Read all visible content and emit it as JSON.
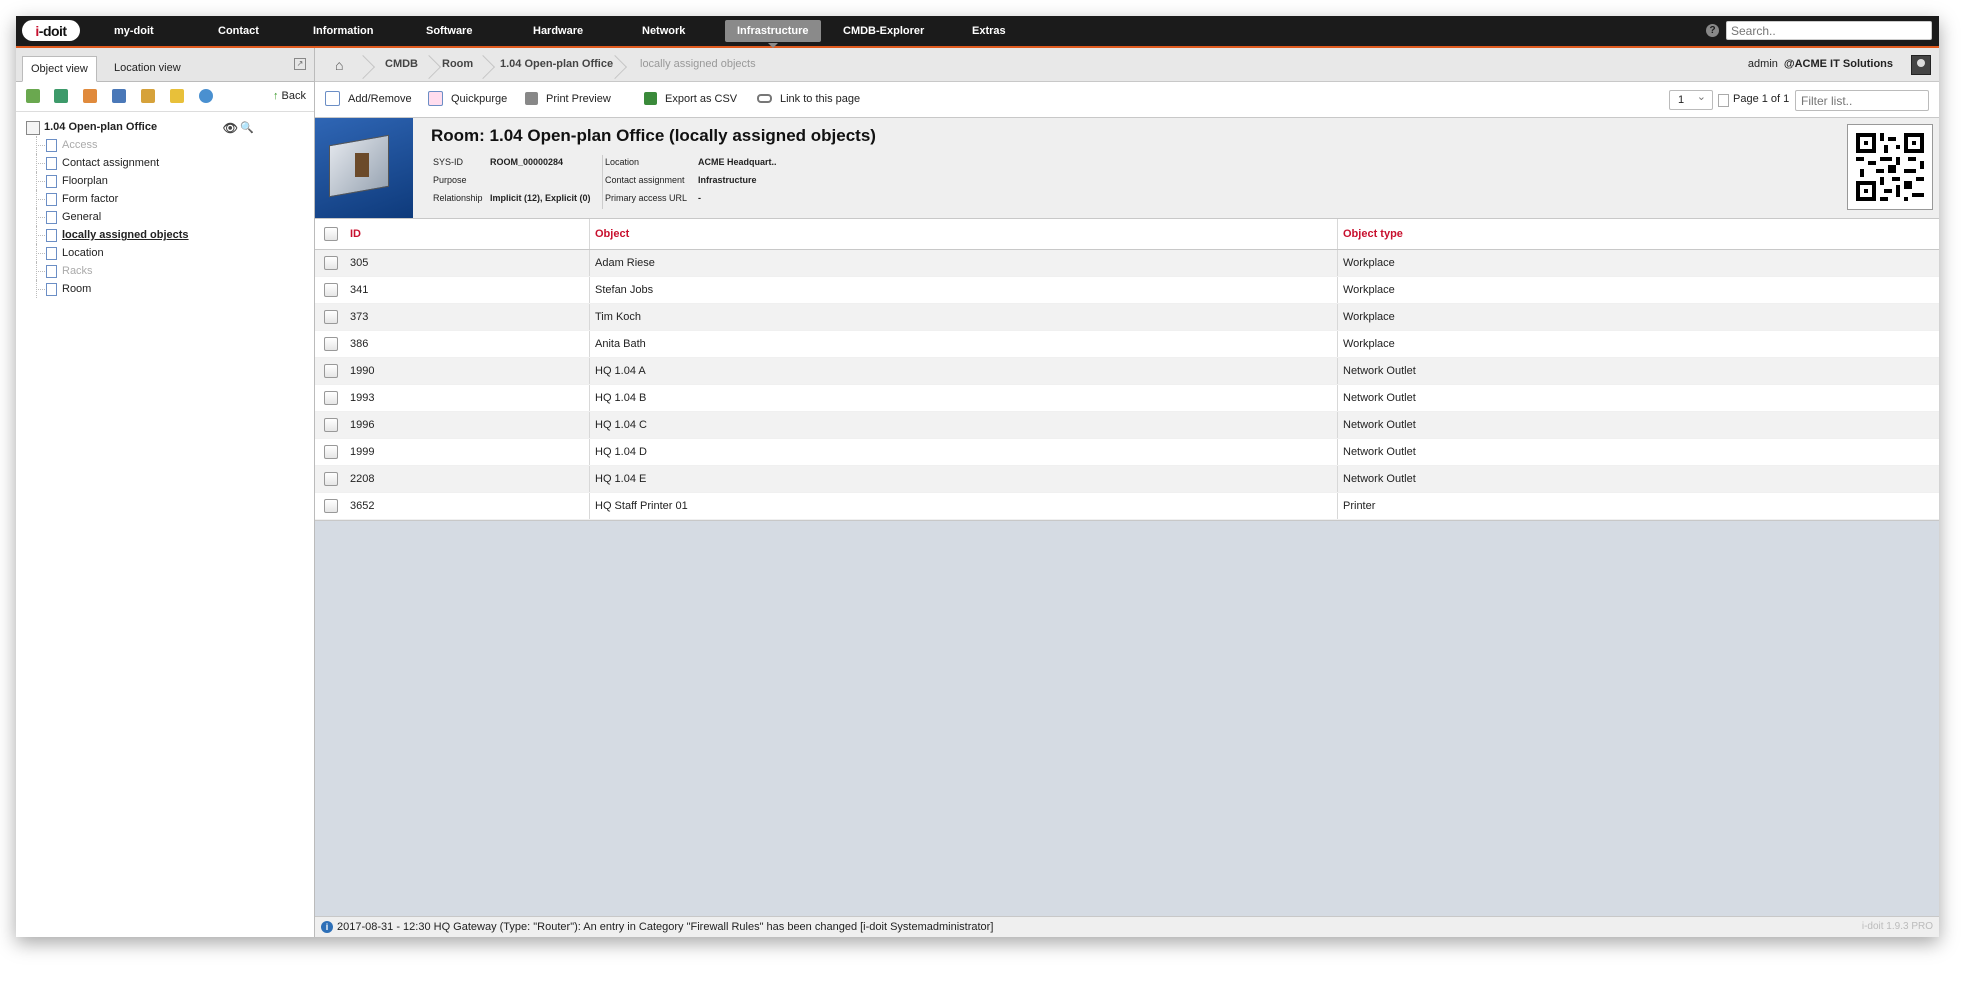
{
  "topnav": {
    "logo": "i-doit",
    "items": [
      "my-doit",
      "Contact",
      "Information",
      "Software",
      "Hardware",
      "Network",
      "Infrastructure",
      "CMDB-Explorer",
      "Extras"
    ],
    "active": "Infrastructure",
    "search_placeholder": "Search.."
  },
  "left_panel": {
    "tabs": [
      "Object view",
      "Location view"
    ],
    "back_label": "Back",
    "toolbar_icons": [
      "tree-icon",
      "expand-icon",
      "report-icon",
      "book-icon",
      "lock-icon",
      "shield-icon",
      "globe-icon"
    ],
    "tree": {
      "root": "1.04 Open-plan Office",
      "items": [
        {
          "label": "Access",
          "state": "disabled"
        },
        {
          "label": "Contact assignment",
          "state": "normal"
        },
        {
          "label": "Floorplan",
          "state": "normal"
        },
        {
          "label": "Form factor",
          "state": "normal"
        },
        {
          "label": "General",
          "state": "normal"
        },
        {
          "label": "locally assigned objects",
          "state": "selected"
        },
        {
          "label": "Location",
          "state": "normal"
        },
        {
          "label": "Racks",
          "state": "disabled"
        },
        {
          "label": "Room",
          "state": "normal"
        }
      ]
    }
  },
  "breadcrumb": [
    "CMDB",
    "Room",
    "1.04 Open-plan Office",
    "locally assigned objects"
  ],
  "user": {
    "name": "admin",
    "tenant": "@ACME IT Solutions"
  },
  "actions": [
    "Add/Remove",
    "Quickpurge",
    "Print Preview",
    "Export as CSV",
    "Link to this page"
  ],
  "pager": {
    "selected": "1",
    "label": "Page 1 of 1",
    "filter_placeholder": "Filter list.."
  },
  "object": {
    "title": "Room: 1.04 Open-plan Office (locally assigned objects)",
    "left_fields": [
      {
        "label": "SYS-ID",
        "value": "ROOM_00000284"
      },
      {
        "label": "Purpose",
        "value": ""
      },
      {
        "label": "Relationship",
        "value": "Implicit (12), Explicit (0)"
      }
    ],
    "right_fields": [
      {
        "label": "Location",
        "value": "ACME Headquart.."
      },
      {
        "label": "Contact assignment",
        "value": "Infrastructure"
      },
      {
        "label": "Primary access URL",
        "value": "-"
      }
    ]
  },
  "table": {
    "columns": [
      "ID",
      "Object",
      "Object type"
    ],
    "rows": [
      [
        "305",
        "Adam Riese",
        "Workplace"
      ],
      [
        "341",
        "Stefan Jobs",
        "Workplace"
      ],
      [
        "373",
        "Tim Koch",
        "Workplace"
      ],
      [
        "386",
        "Anita Bath",
        "Workplace"
      ],
      [
        "1990",
        "HQ 1.04 A",
        "Network Outlet"
      ],
      [
        "1993",
        "HQ 1.04 B",
        "Network Outlet"
      ],
      [
        "1996",
        "HQ 1.04 C",
        "Network Outlet"
      ],
      [
        "1999",
        "HQ 1.04 D",
        "Network Outlet"
      ],
      [
        "2208",
        "HQ 1.04 E",
        "Network Outlet"
      ],
      [
        "3652",
        "HQ Staff Printer 01",
        "Printer"
      ]
    ]
  },
  "status": {
    "message": "2017-08-31 - 12:30 HQ Gateway (Type: \"Router\"): An entry in Category \"Firewall Rules\" has been changed [i-doit Systemadministrator]",
    "version": "i-doit 1.9.3 PRO"
  },
  "colors": {
    "accent": "#e05a1e",
    "header_text": "#c8102e",
    "nav_bg": "#1b1b1b"
  }
}
